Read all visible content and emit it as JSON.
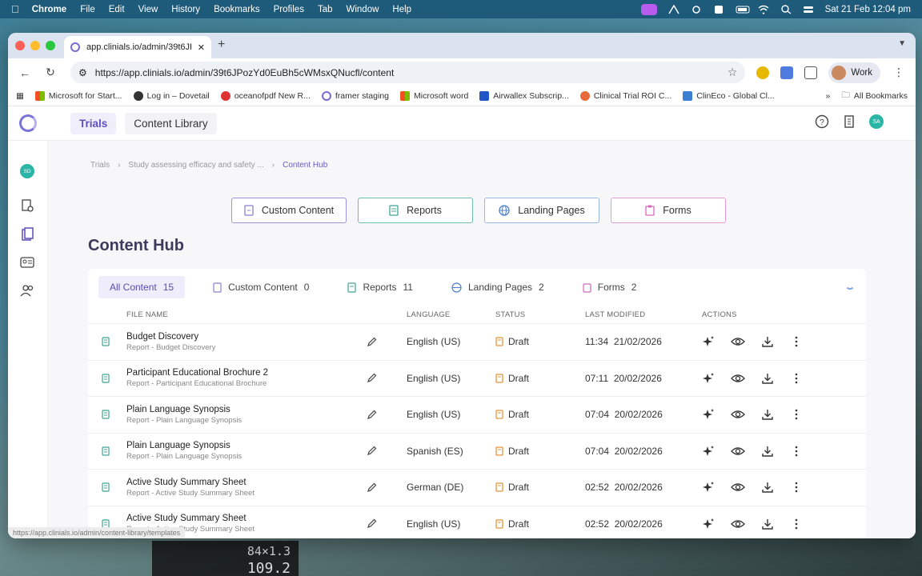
{
  "menubar": {
    "app": "Chrome",
    "items": [
      "File",
      "Edit",
      "View",
      "History",
      "Bookmarks",
      "Profiles",
      "Tab",
      "Window",
      "Help"
    ],
    "clock": "Sat 21 Feb  12:04 pm"
  },
  "desktop": {
    "readout_line1": "84×1.3",
    "readout_line2": "109.2"
  },
  "browser": {
    "tab_title": "app.clinials.io/admin/39t6JPo",
    "url": "https://app.clinials.io/admin/39t6JPozYd0EuBh5cWMsxQNucfl/content",
    "profile": "Work",
    "bookmarks": [
      "Microsoft for Start...",
      "Log in – Dovetail",
      "oceanofpdf New R...",
      "framer staging",
      "Microsoft word",
      "Airwallex Subscrip...",
      "Clinical Trial ROI C...",
      "ClinEco - Global Cl..."
    ],
    "all_bookmarks": "All Bookmarks",
    "status_url": "https://app.clinials.io/admin/content-library/templates"
  },
  "app": {
    "nav": {
      "trials": "Trials",
      "content_library": "Content Library"
    },
    "user_initials": "SA",
    "sidebar_initials": "SD",
    "breadcrumb": {
      "root": "Trials",
      "study": "Study assessing efficacy and safety ...",
      "current": "Content Hub"
    },
    "actions": {
      "custom": "Custom Content",
      "reports": "Reports",
      "landing": "Landing Pages",
      "forms": "Forms"
    },
    "title": "Content Hub",
    "filters": [
      {
        "label": "All Content",
        "count": "15"
      },
      {
        "label": "Custom Content",
        "count": "0"
      },
      {
        "label": "Reports",
        "count": "11"
      },
      {
        "label": "Landing Pages",
        "count": "2"
      },
      {
        "label": "Forms",
        "count": "2"
      }
    ],
    "columns": {
      "name": "FILE NAME",
      "lang": "LANGUAGE",
      "status": "STATUS",
      "modified": "LAST MODIFIED",
      "actions": "ACTIONS"
    },
    "rows": [
      {
        "name": "Budget Discovery",
        "sub": "Report - Budget Discovery",
        "lang": "English (US)",
        "status": "Draft",
        "time": "11:34",
        "date": "21/02/2026"
      },
      {
        "name": "Participant Educational Brochure 2",
        "sub": "Report - Participant Educational Brochure",
        "lang": "English (US)",
        "status": "Draft",
        "time": "07:11",
        "date": "20/02/2026"
      },
      {
        "name": "Plain Language Synopsis",
        "sub": "Report - Plain Language Synopsis",
        "lang": "English (US)",
        "status": "Draft",
        "time": "07:04",
        "date": "20/02/2026"
      },
      {
        "name": "Plain Language Synopsis",
        "sub": "Report - Plain Language Synopsis",
        "lang": "Spanish (ES)",
        "status": "Draft",
        "time": "07:04",
        "date": "20/02/2026"
      },
      {
        "name": "Active Study Summary Sheet",
        "sub": "Report - Active Study Summary Sheet",
        "lang": "German (DE)",
        "status": "Draft",
        "time": "02:52",
        "date": "20/02/2026"
      },
      {
        "name": "Active Study Summary Sheet",
        "sub": "Report - Active Study Summary Sheet",
        "lang": "English (US)",
        "status": "Draft",
        "time": "02:52",
        "date": "20/02/2026"
      }
    ]
  },
  "colors": {
    "accent": "#5d4fb8",
    "teal": "#2bb5a6",
    "draft": "#e8953a"
  }
}
